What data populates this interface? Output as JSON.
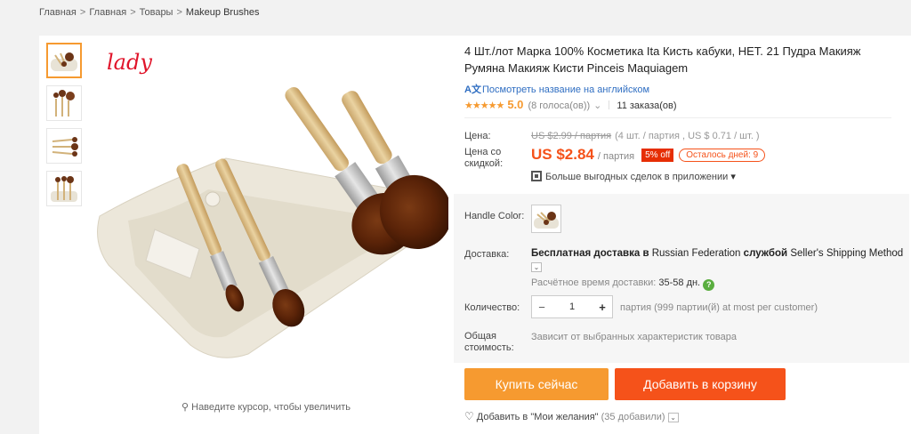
{
  "breadcrumb": [
    "Главная",
    "Главная",
    "Товары",
    "Makeup Brushes"
  ],
  "gallery": {
    "watermark": "lady",
    "zoom_hint": "Наведите курсор, чтобы увеличить",
    "thumbnails": 4
  },
  "product": {
    "title": "4 Шт./лот Марка 100% Косметика Ita Кисть кабуки, НЕТ. 21 Пудра Макияж Румяна Макияж Кисти Pinceis Maquiagem",
    "translate_link": "Посмотреть название на английском",
    "rating": {
      "stars": "★★★★★",
      "score": "5.0",
      "votes": "(8 голоса(ов))"
    },
    "orders": "11 заказа(ов)"
  },
  "price": {
    "label": "Цена:",
    "old": "US $2.99 / партия",
    "old_extra": "(4 шт. / партия , US $ 0.71 / шт. )",
    "discount_label": "Цена со скидкой:",
    "new": "US $2.84",
    "per_lot": "/ партия",
    "discount_badge": "5% off",
    "days_left": "Осталось дней: 9",
    "app_deals": "Больше выгодных сделок в приложении"
  },
  "color": {
    "label": "Handle Color:"
  },
  "shipping": {
    "label": "Доставка:",
    "free": "Бесплатная доставка",
    "in_word": "в",
    "country": "Russian Federation",
    "by_word": "службой",
    "method": "Seller's Shipping Method",
    "est_label": "Расчётное время доставки:",
    "est_value": "35-58 дн."
  },
  "quantity": {
    "label": "Количество:",
    "value": "1",
    "note": "партия (999 партии(й) at most per customer)"
  },
  "total": {
    "label": "Общая стоимость:",
    "value": "Зависит от выбранных характеристик товара"
  },
  "actions": {
    "buy": "Купить сейчас",
    "cart": "Добавить в корзину"
  },
  "wishlist": {
    "label": "Добавить в \"Мои желания\"",
    "count": "(35 добавили)"
  },
  "colors": {
    "accent_orange": "#f69a30",
    "cart_red": "#f5521a",
    "link_blue": "#2f6ec2",
    "badge_red": "#e62e04"
  }
}
